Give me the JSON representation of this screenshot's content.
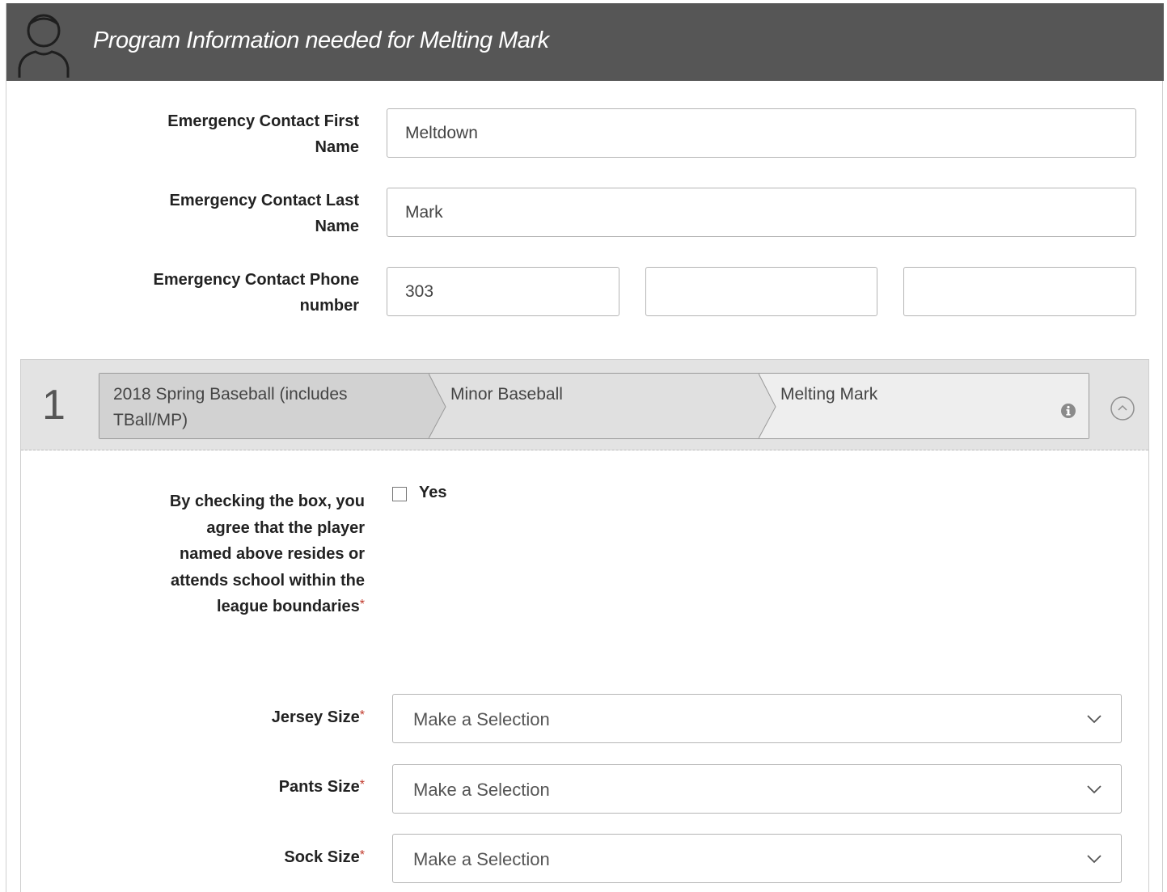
{
  "header": {
    "title": "Program Information needed for Melting Mark",
    "avatar_icon": "user-silhouette-icon"
  },
  "emergency": {
    "first_name": {
      "label_line1": "Emergency Contact First",
      "label_line2": "Name",
      "value": "Meltdown"
    },
    "last_name": {
      "label_line1": "Emergency Contact Last",
      "label_line2": "Name",
      "value": "Mark"
    },
    "phone": {
      "label_line1": "Emergency Contact Phone",
      "label_line2": "number",
      "area_code": "303",
      "prefix": "",
      "line_number": ""
    }
  },
  "program": {
    "number": "1",
    "breadcrumbs": [
      {
        "label_line1": "2018 Spring Baseball (includes",
        "label_line2": "TBall/MP)"
      },
      {
        "label_line1": "Minor Baseball",
        "label_line2": ""
      },
      {
        "label_line1": "Melting Mark",
        "label_line2": ""
      }
    ],
    "info_icon": "info-circle-icon",
    "collapse_icon": "chevron-up-circle-icon"
  },
  "residency": {
    "label_lines": [
      "By checking the box, you",
      "agree that the player",
      "named above resides or",
      "attends school within the",
      "league boundaries"
    ],
    "required_mark": "*",
    "checkbox_label": "Yes",
    "checked": false
  },
  "sizes": [
    {
      "label": "Jersey Size",
      "required_mark": "*",
      "value": "Make a Selection"
    },
    {
      "label": "Pants Size",
      "required_mark": "*",
      "value": "Make a Selection"
    },
    {
      "label": "Sock Size",
      "required_mark": "*",
      "value": "Make a Selection"
    }
  ],
  "colors": {
    "header_bg": "#565656",
    "required": "#c0392b",
    "section_bg": "#e3e3e3"
  }
}
